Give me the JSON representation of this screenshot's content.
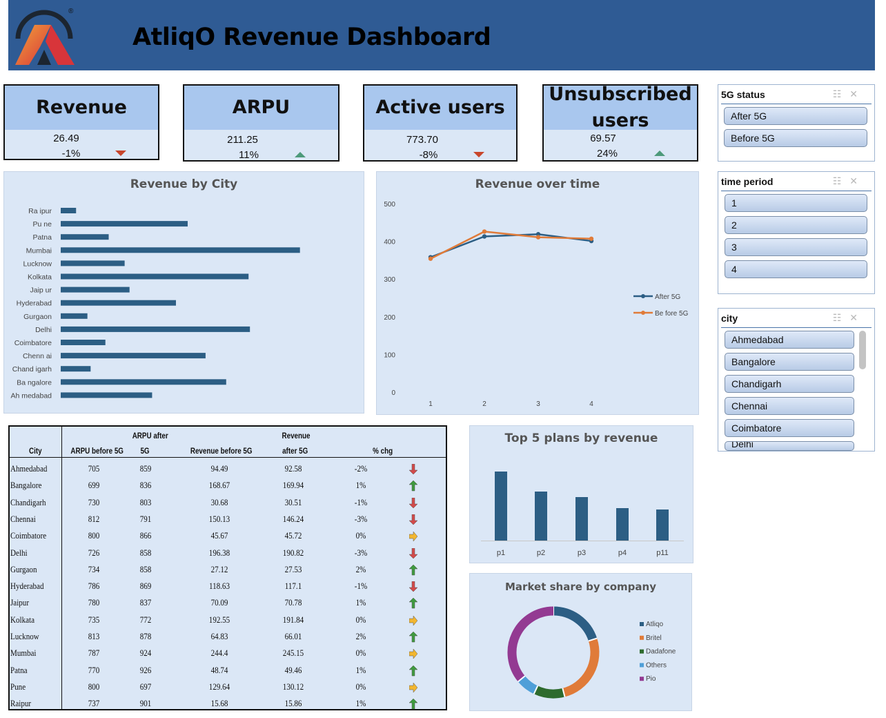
{
  "header": {
    "title": "AtliqO Revenue Dashboard",
    "logo_icon": "atliqo-logo-icon",
    "registered_mark": "®",
    "background": "#2f5b94"
  },
  "kpis": [
    {
      "label": "Revenue",
      "value": "26.49",
      "change": "-1%",
      "trend": "down"
    },
    {
      "label": "ARPU",
      "value": "211.25",
      "change": "11%",
      "trend": "up"
    },
    {
      "label": "Active users",
      "value": "773.70",
      "change": "-8%",
      "trend": "down"
    },
    {
      "label": "Unsubscribed users",
      "value": "69.57",
      "change": "24%",
      "trend": "up"
    }
  ],
  "slicers": {
    "status": {
      "title": "5G status",
      "items": [
        "After 5G",
        "Before 5G"
      ]
    },
    "period": {
      "title": "time period",
      "items": [
        "1",
        "2",
        "3",
        "4"
      ]
    },
    "city": {
      "title": "city",
      "items": [
        "Ahmedabad",
        "Bangalore",
        "Chandigarh",
        "Chennai",
        "Coimbatore",
        "Delhi"
      ]
    }
  },
  "revenue_by_city": {
    "title": "Revenue by City",
    "chart_data": {
      "type": "bar",
      "orientation": "horizontal",
      "categories": [
        "Ra ipur",
        "Pu ne",
        "Patna",
        "Mumbai",
        "Lucknow",
        "Kolkata",
        "Jaip ur",
        "Hyderabad",
        "Gurgaon",
        "Delhi",
        "Coimbatore",
        "Chenn ai",
        "Chand igarh",
        "Ba ngalore",
        "Ah medabad"
      ],
      "values": [
        15.7,
        129.9,
        49.1,
        244.8,
        65.4,
        192.2,
        70.4,
        117.9,
        27.3,
        193.6,
        45.7,
        148.2,
        30.6,
        169.3,
        93.5
      ],
      "color": "#2c5e84"
    }
  },
  "revenue_over_time": {
    "title": "Revenue over time",
    "chart_data": {
      "type": "line",
      "x": [
        1,
        2,
        3,
        4
      ],
      "ylim": [
        0,
        500
      ],
      "yticks": [
        0,
        100,
        200,
        300,
        400,
        500
      ],
      "series": [
        {
          "name": "After 5G",
          "values": [
            358,
            413,
            419,
            401
          ],
          "color": "#2c5e84"
        },
        {
          "name": "Be fore 5G",
          "values": [
            354,
            426,
            411,
            407
          ],
          "color": "#e07b39"
        }
      ],
      "legend": "right"
    }
  },
  "top_plans": {
    "title": "Top 5 plans by revenue",
    "chart_data": {
      "type": "bar",
      "categories": [
        "p1",
        "p2",
        "p3",
        "p4",
        "p11"
      ],
      "values": [
        100,
        71,
        63,
        47,
        45
      ],
      "color": "#2c5e84"
    }
  },
  "market_share": {
    "title": "Market share by company",
    "chart_data": {
      "type": "pie",
      "donut": true,
      "categories": [
        "Atliqo",
        "Britel",
        "Dadafone",
        "Others",
        "Pio"
      ],
      "values": [
        20,
        26,
        11,
        7,
        36
      ],
      "colors": [
        "#2c5e84",
        "#e07b39",
        "#2e6b2e",
        "#4f9fd8",
        "#933a92"
      ],
      "legend": "right"
    }
  },
  "city_table": {
    "headers": {
      "city": "City",
      "arpu_before": "ARPU before 5G",
      "arpu_after_1": "ARPU after",
      "arpu_after_2": "5G",
      "rev_before": "Revenue before 5G",
      "rev_after_1": "Revenue",
      "rev_after_2": "after 5G",
      "chg": "% chg"
    },
    "rows": [
      {
        "city": "Ahmedabad",
        "arpu_before": "705",
        "arpu_after": "859",
        "rev_before": "94.49",
        "rev_after": "92.58",
        "chg": "-2%",
        "trend": "down"
      },
      {
        "city": "Bangalore",
        "arpu_before": "699",
        "arpu_after": "836",
        "rev_before": "168.67",
        "rev_after": "169.94",
        "chg": "1%",
        "trend": "up"
      },
      {
        "city": "Chandigarh",
        "arpu_before": "730",
        "arpu_after": "803",
        "rev_before": "30.68",
        "rev_after": "30.51",
        "chg": "-1%",
        "trend": "down"
      },
      {
        "city": "Chennai",
        "arpu_before": "812",
        "arpu_after": "791",
        "rev_before": "150.13",
        "rev_after": "146.24",
        "chg": "-3%",
        "trend": "down"
      },
      {
        "city": "Coimbatore",
        "arpu_before": "800",
        "arpu_after": "866",
        "rev_before": "45.67",
        "rev_after": "45.72",
        "chg": "0%",
        "trend": "flat"
      },
      {
        "city": "Delhi",
        "arpu_before": "726",
        "arpu_after": "858",
        "rev_before": "196.38",
        "rev_after": "190.82",
        "chg": "-3%",
        "trend": "down"
      },
      {
        "city": "Gurgaon",
        "arpu_before": "734",
        "arpu_after": "858",
        "rev_before": "27.12",
        "rev_after": "27.53",
        "chg": "2%",
        "trend": "up"
      },
      {
        "city": "Hyderabad",
        "arpu_before": "786",
        "arpu_after": "869",
        "rev_before": "118.63",
        "rev_after": "117.1",
        "chg": "-1%",
        "trend": "down"
      },
      {
        "city": "Jaipur",
        "arpu_before": "780",
        "arpu_after": "837",
        "rev_before": "70.09",
        "rev_after": "70.78",
        "chg": "1%",
        "trend": "up"
      },
      {
        "city": "Kolkata",
        "arpu_before": "735",
        "arpu_after": "772",
        "rev_before": "192.55",
        "rev_after": "191.84",
        "chg": "0%",
        "trend": "flat"
      },
      {
        "city": "Lucknow",
        "arpu_before": "813",
        "arpu_after": "878",
        "rev_before": "64.83",
        "rev_after": "66.01",
        "chg": "2%",
        "trend": "up"
      },
      {
        "city": "Mumbai",
        "arpu_before": "787",
        "arpu_after": "924",
        "rev_before": "244.4",
        "rev_after": "245.15",
        "chg": "0%",
        "trend": "flat"
      },
      {
        "city": "Patna",
        "arpu_before": "770",
        "arpu_after": "926",
        "rev_before": "48.74",
        "rev_after": "49.46",
        "chg": "1%",
        "trend": "up"
      },
      {
        "city": "Pune",
        "arpu_before": "800",
        "arpu_after": "697",
        "rev_before": "129.64",
        "rev_after": "130.12",
        "chg": "0%",
        "trend": "flat"
      },
      {
        "city": "Raipur",
        "arpu_before": "737",
        "arpu_after": "901",
        "rev_before": "15.68",
        "rev_after": "15.86",
        "chg": "1%",
        "trend": "up"
      }
    ]
  }
}
